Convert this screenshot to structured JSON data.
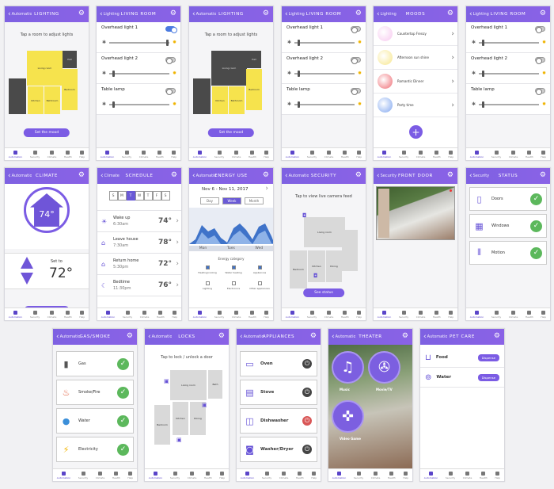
{
  "screens": {
    "lighting1": {
      "back": "Automation",
      "title": "LIGHTING",
      "hint": "Tap a room to adjust lights",
      "button": "Set the mood",
      "rooms": [
        "Living room",
        "Kitchen",
        "Bathroom",
        "Bedroom",
        "Hall"
      ]
    },
    "living1": {
      "back": "Lighting",
      "title": "LIVING ROOM",
      "lights": [
        {
          "label": "Overhead light 1",
          "on": true,
          "level": 0.95
        },
        {
          "label": "Overhead light 2",
          "on": false,
          "level": 0.05
        },
        {
          "label": "Table lamp",
          "on": false,
          "level": 0.05
        }
      ]
    },
    "lighting2": {
      "back": "Automation",
      "title": "LIGHTING",
      "hint": "Tap a room to adjust lights",
      "button": "Set the mood",
      "rooms": [
        "Living room",
        "Kitchen",
        "Bathroom",
        "Bedroom",
        "Hall"
      ]
    },
    "living2": {
      "back": "Lighting",
      "title": "LIVING ROOM",
      "lights": [
        {
          "label": "Overhead light 1",
          "on": false,
          "level": 0.05
        },
        {
          "label": "Overhead light 2",
          "on": false,
          "level": 0.05
        },
        {
          "label": "Table lamp",
          "on": false,
          "level": 0.05
        }
      ]
    },
    "moods": {
      "back": "Lighting",
      "title": "MOODS",
      "items": [
        {
          "label": "Countertop Frenzy",
          "color": "#f7c8ef"
        },
        {
          "label": "Afternoon sun shine",
          "color": "#f7e68a"
        },
        {
          "label": "Romantic Dinner",
          "color": "#ef6a72"
        },
        {
          "label": "Party time",
          "color": "#7ea5ef"
        }
      ],
      "add": "+"
    },
    "living3": {
      "back": "Lighting",
      "title": "LIVING ROOM",
      "lights": [
        {
          "label": "Overhead light 1",
          "on": false,
          "level": 0.05
        },
        {
          "label": "Overhead light 2",
          "on": false,
          "level": 0.05
        },
        {
          "label": "Table lamp",
          "on": false,
          "level": 0.05
        }
      ]
    },
    "climate": {
      "back": "Automation",
      "title": "CLIMATE",
      "current": "74°",
      "set_label": "Set to",
      "set_value": "72°",
      "button": "Set schedule"
    },
    "schedule": {
      "back": "Climate",
      "title": "SCHEDULE",
      "days": [
        "S",
        "M",
        "T",
        "W",
        "T",
        "F",
        "S"
      ],
      "selected_day": 2,
      "items": [
        {
          "name": "Wake up",
          "time": "6:30am",
          "temp": "74°",
          "icon": "☀"
        },
        {
          "name": "Leave house",
          "time": "7:30am",
          "temp": "78°",
          "icon": "⌂"
        },
        {
          "name": "Return home",
          "time": "5:30pm",
          "temp": "72°",
          "icon": "⌂"
        },
        {
          "name": "Bedtime",
          "time": "11:30pm",
          "temp": "76°",
          "icon": "☾"
        }
      ]
    },
    "energy": {
      "back": "Automation",
      "title": "ENERGY USE",
      "range": "Nov 6 - Nov 11, 2017",
      "views": [
        "Day",
        "Week",
        "Month"
      ],
      "selected_view": 1,
      "days": [
        "Mon",
        "Tues",
        "Wed"
      ],
      "categories_title": "Energy category",
      "categories": [
        "Heating/cooling",
        "Water heating",
        "Appliances",
        "Lighting",
        "Electronics",
        "Other appliances"
      ]
    },
    "security": {
      "back": "Automation",
      "title": "SECURITY",
      "hint": "Tap to view live camera feed",
      "rooms": [
        "Living room",
        "Bedroom",
        "Kitchen",
        "Dining"
      ],
      "button": "See status"
    },
    "frontdoor": {
      "back": "Security",
      "title": "FRONT DOOR"
    },
    "status": {
      "back": "Security",
      "title": "STATUS",
      "items": [
        {
          "label": "Doors",
          "icon": "▯"
        },
        {
          "label": "Windows",
          "icon": "▦"
        },
        {
          "label": "Motion",
          "icon": "⦀"
        }
      ]
    },
    "gas": {
      "back": "Automation",
      "title": "GAS/SMOKE",
      "items": [
        {
          "label": "Gas",
          "icon": "▮",
          "color": "#555"
        },
        {
          "label": "Smoke/Fire",
          "icon": "♨",
          "color": "#e15b3a"
        },
        {
          "label": "Water",
          "icon": "●",
          "color": "#3b8fd9"
        },
        {
          "label": "Electricity",
          "icon": "⚡",
          "color": "#f1b500"
        }
      ]
    },
    "locks": {
      "back": "Automation",
      "title": "LOCKS",
      "hint": "Tap to lock / unlock a door",
      "rooms": [
        "Living room",
        "Bedroom",
        "Kitchen",
        "Dining",
        "Bath"
      ]
    },
    "appliances": {
      "back": "Automation",
      "title": "APPLIANCES",
      "items": [
        {
          "label": "Oven",
          "icon": "▭"
        },
        {
          "label": "Stove",
          "icon": "▤"
        },
        {
          "label": "Dishwasher",
          "icon": "◫"
        },
        {
          "label": "Washer/Dryer",
          "icon": "◙"
        }
      ]
    },
    "theater": {
      "back": "Automation",
      "title": "THEATER",
      "items": [
        {
          "label": "Music",
          "icon": "♫"
        },
        {
          "label": "Movie/TV",
          "icon": "✇"
        },
        {
          "label": "Video Game",
          "icon": "✜"
        }
      ]
    },
    "petcare": {
      "back": "Automation",
      "title": "PET CARE",
      "items": [
        {
          "label": "Food",
          "button": "Dispense"
        },
        {
          "label": "Water",
          "button": "Dispense"
        }
      ]
    }
  },
  "tabbar": [
    "Automation",
    "Security",
    "Climate",
    "Health",
    "Help"
  ]
}
